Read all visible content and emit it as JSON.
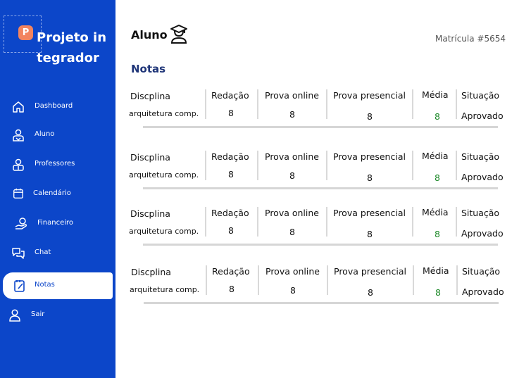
{
  "app": {
    "brand": "Projeto integrador",
    "logo_letter": "P"
  },
  "sidebar": {
    "items": [
      {
        "label": "Dashboard",
        "icon": "home-icon"
      },
      {
        "label": "Aluno",
        "icon": "student-icon"
      },
      {
        "label": "Professores",
        "icon": "teacher-icon"
      },
      {
        "label": "Calendário",
        "icon": "calendar-icon"
      },
      {
        "label": "Financeiro",
        "icon": "finance-icon"
      },
      {
        "label": "Chat",
        "icon": "chat-icon"
      },
      {
        "label": "Notas",
        "icon": "notes-icon",
        "active": true
      },
      {
        "label": "Sair",
        "icon": "user-icon"
      }
    ]
  },
  "header": {
    "title": "Aluno",
    "title_icon": "graduate-icon",
    "matricula": "Matrícula #5654"
  },
  "main": {
    "section_title": "Notas",
    "columns": [
      "Discplina",
      "Redação",
      "Prova online",
      "Prova presencial",
      "Média",
      "Situação"
    ],
    "rows": [
      {
        "disciplina": "arquitetura comp.",
        "redacao": "8",
        "prova_online": "8",
        "prova_presencial": "8",
        "media": "8",
        "situacao": "Aprovado"
      },
      {
        "disciplina": "arquitetura comp.",
        "redacao": "8",
        "prova_online": "8",
        "prova_presencial": "8",
        "media": "8",
        "situacao": "Aprovado"
      },
      {
        "disciplina": "arquitetura comp.",
        "redacao": "8",
        "prova_online": "8",
        "prova_presencial": "8",
        "media": "8",
        "situacao": "Aprovado"
      },
      {
        "disciplina": "arquitetura comp.",
        "redacao": "8",
        "prova_online": "8",
        "prova_presencial": "8",
        "media": "8",
        "situacao": "Aprovado"
      }
    ]
  },
  "colors": {
    "sidebar": "#0c46c9",
    "accent": "#f2845f",
    "media": "#1e8a2a",
    "section_title": "#1f3578"
  }
}
